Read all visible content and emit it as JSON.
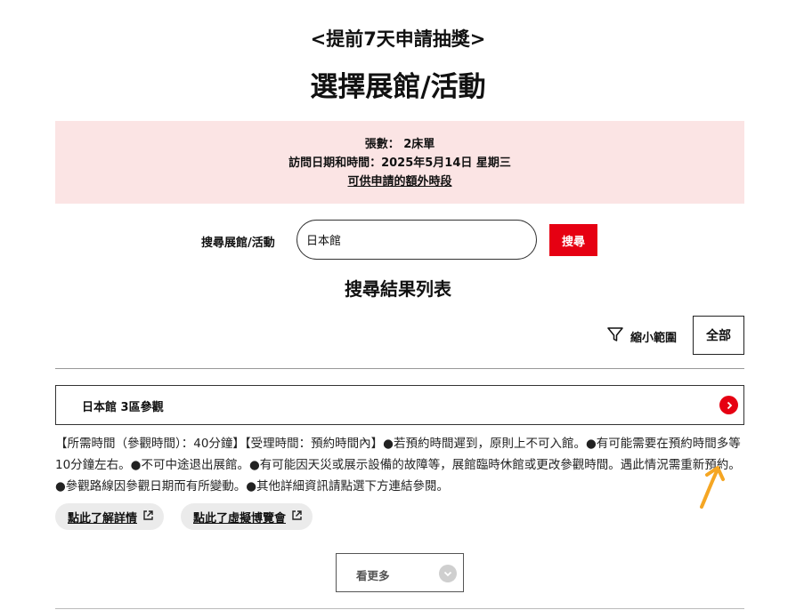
{
  "header": {
    "subtitle": "<提前7天申請抽獎>",
    "title": "選擇展館/活動"
  },
  "info": {
    "ticket_count": "張數： 2床單",
    "visit_datetime": "訪問日期和時間：2025年5月14日 星期三",
    "extra_slots_link": "可供申請的額外時段"
  },
  "search": {
    "label": "搜尋展館/活動",
    "value": "日本館",
    "button_label": "搜尋"
  },
  "results": {
    "title": "搜尋結果列表",
    "filter_label": "縮小範圍",
    "all_label": "全部",
    "items": [
      {
        "name": "日本館 3區參觀",
        "description": "【所需時間（參觀時間）：40分鐘】【受理時間：預約時間內】●若預約時間遲到，原則上不可入館。●有可能需要在預約時間多等10分鐘左右。●不可中途退出展館。●有可能因天災或展示設備的故障等，展館臨時休館或更改參觀時間。遇此情況需重新預約。●參觀路線因參觀日期而有所變動。●其他詳細資訊請點選下方連結參閱。",
        "links": [
          "點此了解詳情",
          "點此了虛擬博覽會"
        ]
      }
    ],
    "see_more_label": "看更多"
  },
  "colors": {
    "brand_red": "#e60012",
    "info_bg": "#fbe4e4",
    "annotation_orange": "#f5a623"
  },
  "icons": {
    "filter": "funnel-icon",
    "go": "chevron-right-icon",
    "external": "external-link-icon",
    "more": "chevron-down-icon"
  }
}
